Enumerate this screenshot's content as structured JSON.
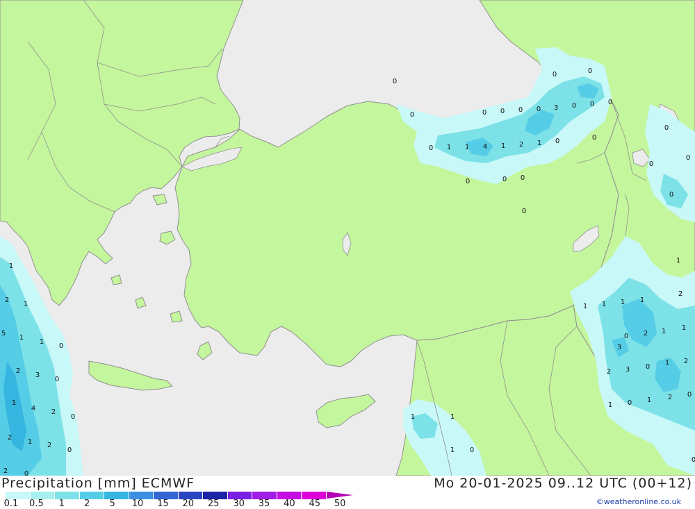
{
  "title": "Precipitation [mm] ECMWF",
  "timestamp": "Mo 20-01-2025 09..12 UTC (00+12)",
  "credit": "©weatheronline.co.uk",
  "colors": {
    "sea": "#ececec",
    "land": "#c4f69d",
    "border": "#909090"
  },
  "legend": {
    "labels": [
      "0.1",
      "0.5",
      "1",
      "2",
      "5",
      "10",
      "15",
      "20",
      "25",
      "30",
      "35",
      "40",
      "45",
      "50"
    ],
    "colors": [
      "#c8f8f8",
      "#a6f0f0",
      "#7ce2e8",
      "#56cde6",
      "#35b6e0",
      "#3a8fe0",
      "#3466d6",
      "#2a44c2",
      "#1d22a6",
      "#7c1fe4",
      "#a21ee6",
      "#c40fe4",
      "#de00d8",
      "#b400b6"
    ]
  },
  "precip_values": [
    "0",
    "0",
    "0",
    "0",
    "0",
    "0",
    "3",
    "0",
    "0",
    "0",
    "0",
    "0",
    "0",
    "1",
    "1",
    "4",
    "1",
    "2",
    "1",
    "0",
    "0",
    "0",
    "0",
    "0",
    "0",
    "0",
    "0",
    "0",
    "0",
    "1",
    "2",
    "1",
    "5",
    "1",
    "1",
    "0",
    "2",
    "3",
    "0",
    "1",
    "4",
    "2",
    "0",
    "2",
    "1",
    "2",
    "0",
    "2",
    "0",
    "1",
    "1",
    "1",
    "1",
    "1",
    "1",
    "1",
    "2",
    "1",
    "1",
    "2",
    "0",
    "3",
    "1",
    "2",
    "2",
    "3",
    "0",
    "2",
    "0",
    "1",
    "0",
    "1",
    "1",
    "0",
    "0",
    "0"
  ]
}
